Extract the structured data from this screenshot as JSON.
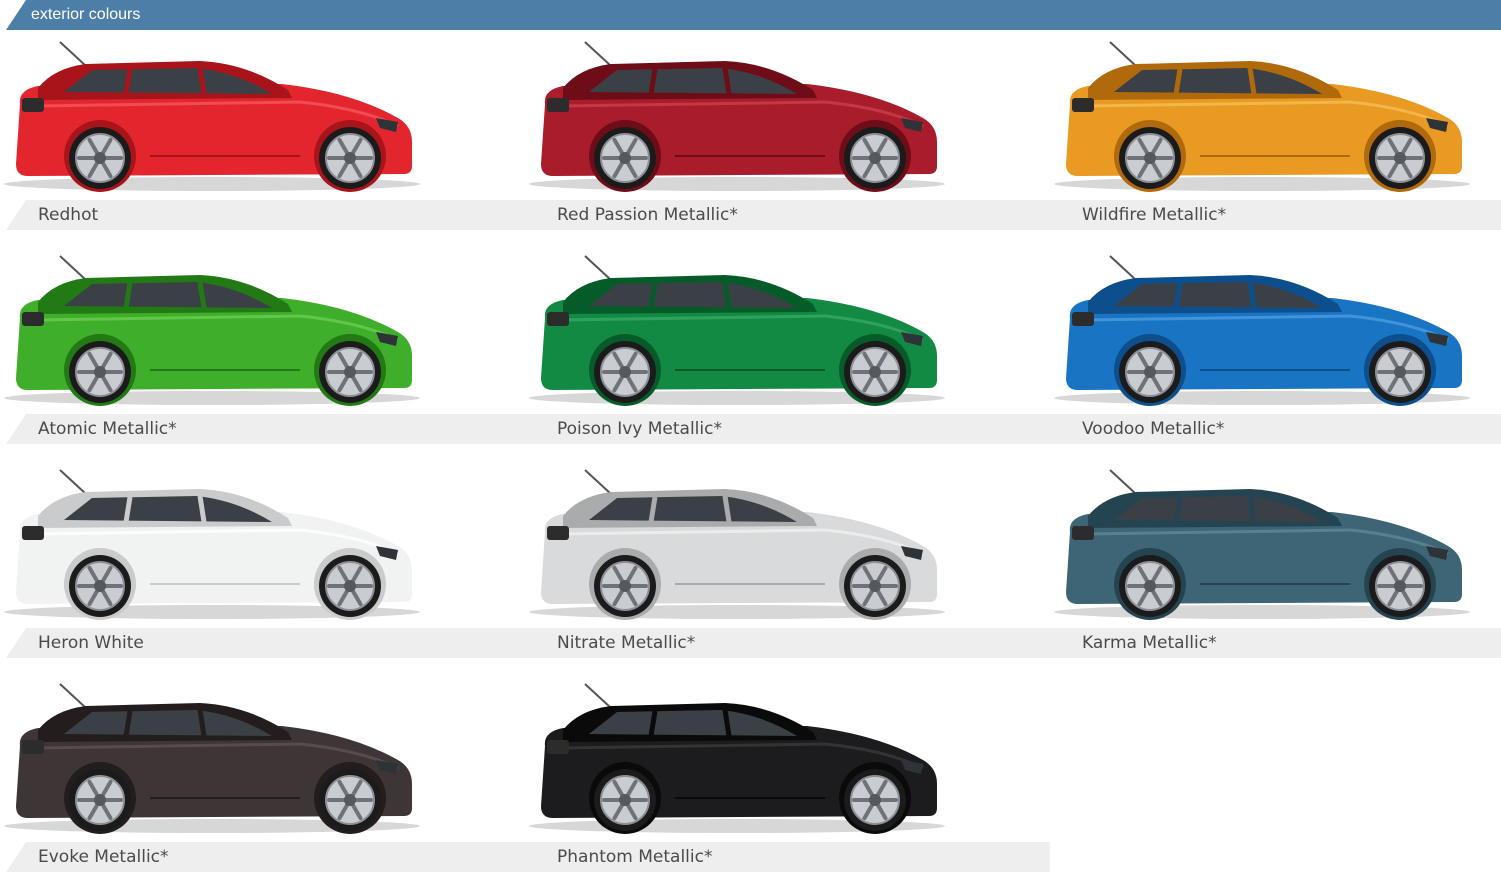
{
  "header": {
    "title": "exterior colours"
  },
  "colours": [
    {
      "name": "Redhot",
      "body": "#e3262e",
      "dark": "#a8141a",
      "light": "#f4555c"
    },
    {
      "name": "Red Passion Metallic*",
      "body": "#a81c2c",
      "dark": "#6e0d17",
      "light": "#c8404f"
    },
    {
      "name": "Wildfire Metallic*",
      "body": "#e89a22",
      "dark": "#b06a0c",
      "light": "#f5bd52"
    },
    {
      "name": "Atomic Metallic*",
      "body": "#3fae2a",
      "dark": "#217a14",
      "light": "#6ccc52"
    },
    {
      "name": "Poison Ivy Metallic*",
      "body": "#138a43",
      "dark": "#065c28",
      "light": "#38a866"
    },
    {
      "name": "Voodoo Metallic*",
      "body": "#1a74c4",
      "dark": "#0d4f8c",
      "light": "#4b9be0"
    },
    {
      "name": "Heron White",
      "body": "#f1f2f2",
      "dark": "#c9cbcd",
      "light": "#ffffff"
    },
    {
      "name": "Nitrate Metallic*",
      "body": "#d9dadb",
      "dark": "#a9abad",
      "light": "#f0f0f0"
    },
    {
      "name": "Karma Metallic*",
      "body": "#3e6575",
      "dark": "#244452",
      "light": "#5f8796"
    },
    {
      "name": "Evoke Metallic*",
      "body": "#3d3536",
      "dark": "#231d1e",
      "light": "#5c5253"
    },
    {
      "name": "Phantom Metallic*",
      "body": "#1c1c1e",
      "dark": "#0a0a0b",
      "light": "#3a3a3d"
    }
  ]
}
